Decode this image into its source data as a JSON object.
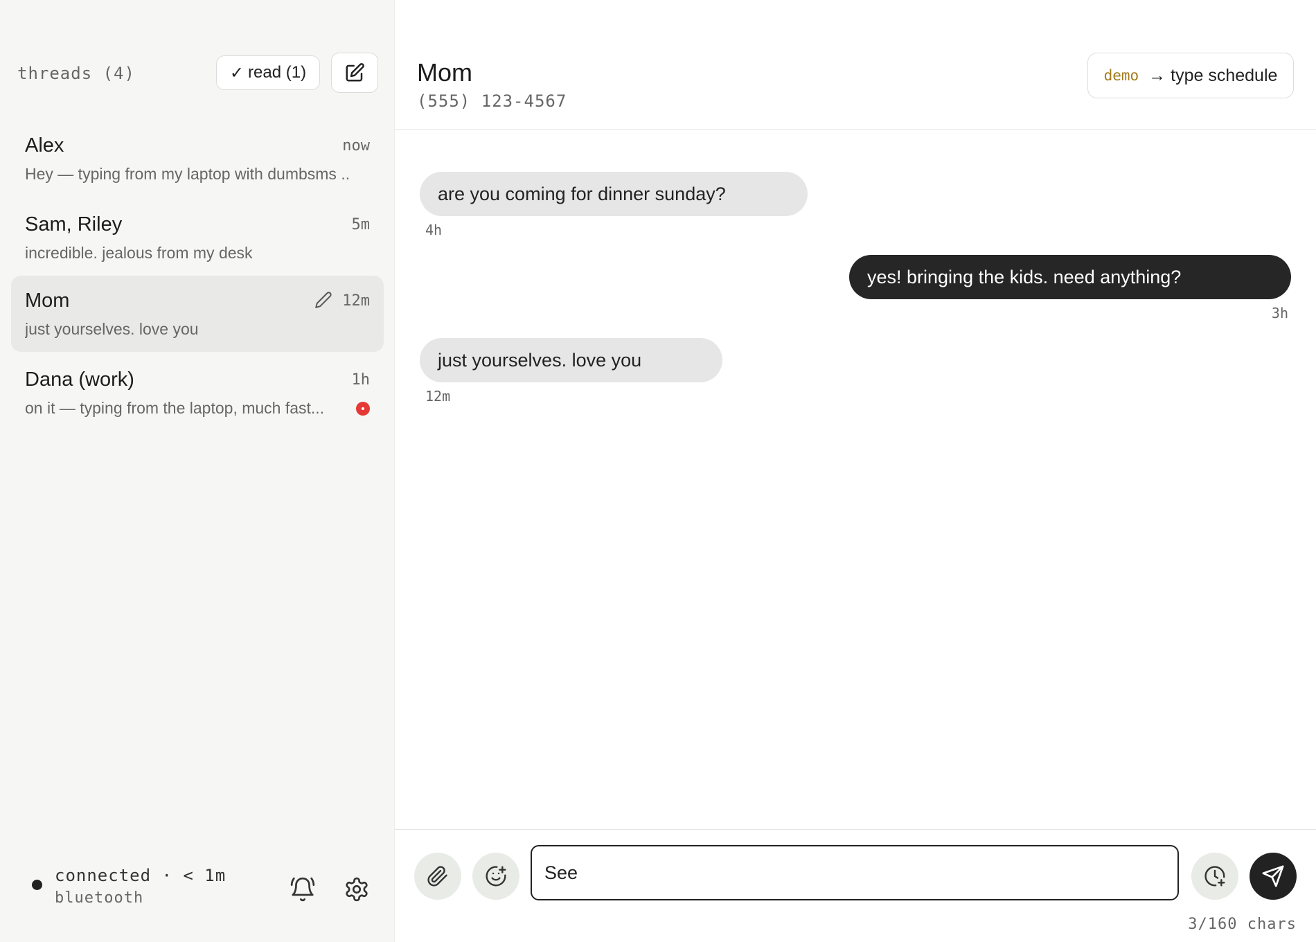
{
  "sidebar": {
    "threads_label": "threads (4)",
    "read_button": "read (1)",
    "threads": [
      {
        "name": "Alex",
        "time": "now",
        "preview": "Hey — typing from my laptop with dumbsms ...",
        "active": false,
        "unread": false
      },
      {
        "name": "Sam, Riley",
        "time": "5m",
        "preview": "incredible. jealous from my desk",
        "active": false,
        "unread": false
      },
      {
        "name": "Mom",
        "time": "12m",
        "preview": "just yourselves. love you",
        "active": true,
        "unread": false
      },
      {
        "name": "Dana (work)",
        "time": "1h",
        "preview": "on it — typing from the laptop, much fast...",
        "active": false,
        "unread": true
      }
    ],
    "status": {
      "line1": "connected · < 1m",
      "line2": "bluetooth"
    }
  },
  "chat": {
    "contact_name": "Mom",
    "contact_phone": "(555) 123-4567",
    "demo": {
      "tag": "demo",
      "label": "type schedule"
    },
    "messages": [
      {
        "direction": "in",
        "text": "are you coming for dinner sunday?",
        "time": "4h"
      },
      {
        "direction": "out",
        "text": "yes! bringing the kids. need anything?",
        "time": "3h"
      },
      {
        "direction": "in",
        "text": "just yourselves. love you",
        "time": "12m"
      }
    ],
    "composer": {
      "value": "See",
      "char_count": "3/160 chars"
    }
  },
  "colors": {
    "accent_dark": "#262626",
    "unread": "#e53935",
    "demo_tag": "#a27b1c"
  }
}
